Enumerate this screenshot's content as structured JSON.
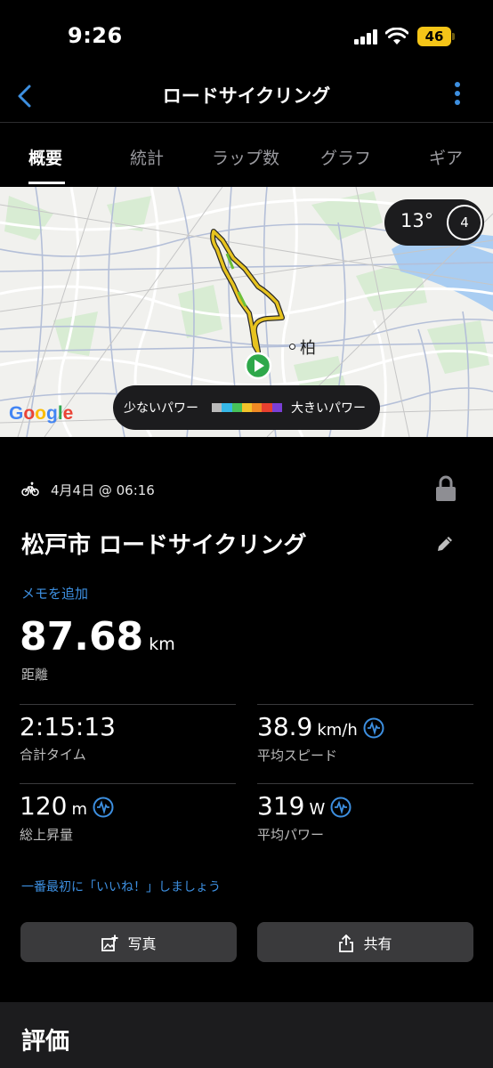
{
  "status_bar": {
    "time": "9:26",
    "battery": "46"
  },
  "header": {
    "title": "ロードサイクリング"
  },
  "tabs": [
    {
      "label": "概要",
      "active": true
    },
    {
      "label": "統計",
      "active": false
    },
    {
      "label": "ラップ数",
      "active": false
    },
    {
      "label": "グラフ",
      "active": false
    },
    {
      "label": "ギア",
      "active": false
    }
  ],
  "map": {
    "temperature": "13°",
    "wind": "4",
    "place": "柏",
    "provider": "Google",
    "power_legend": {
      "low": "少ないパワー",
      "high": "大きいパワー"
    },
    "power_colors": [
      "#b9b9b9",
      "#36b7e6",
      "#47c25a",
      "#f2c32a",
      "#f08a24",
      "#e8402f",
      "#7a3fd6"
    ]
  },
  "activity": {
    "date": "4月4日 @ 06:16",
    "name": "松戸市 ロードサイクリング",
    "add_memo": "メモを追加",
    "distance": {
      "value": "87.68",
      "unit": "km",
      "label": "距離"
    },
    "stats": {
      "time": {
        "value": "2:15:13",
        "unit": "",
        "label": "合計タイム"
      },
      "speed": {
        "value": "38.9",
        "unit": "km/h",
        "label": "平均スピード"
      },
      "ascent": {
        "value": "120",
        "unit": "m",
        "label": "総上昇量"
      },
      "power": {
        "value": "319",
        "unit": "W",
        "label": "平均パワー"
      }
    },
    "like_prompt": "一番最初に「いいね！」しましょう"
  },
  "buttons": {
    "photo": "写真",
    "share": "共有"
  },
  "rating": {
    "title": "評価"
  },
  "colors": {
    "accent": "#3d8fe0",
    "background": "#000000",
    "panel": "#1c1c1e",
    "button": "#3a3a3c"
  }
}
